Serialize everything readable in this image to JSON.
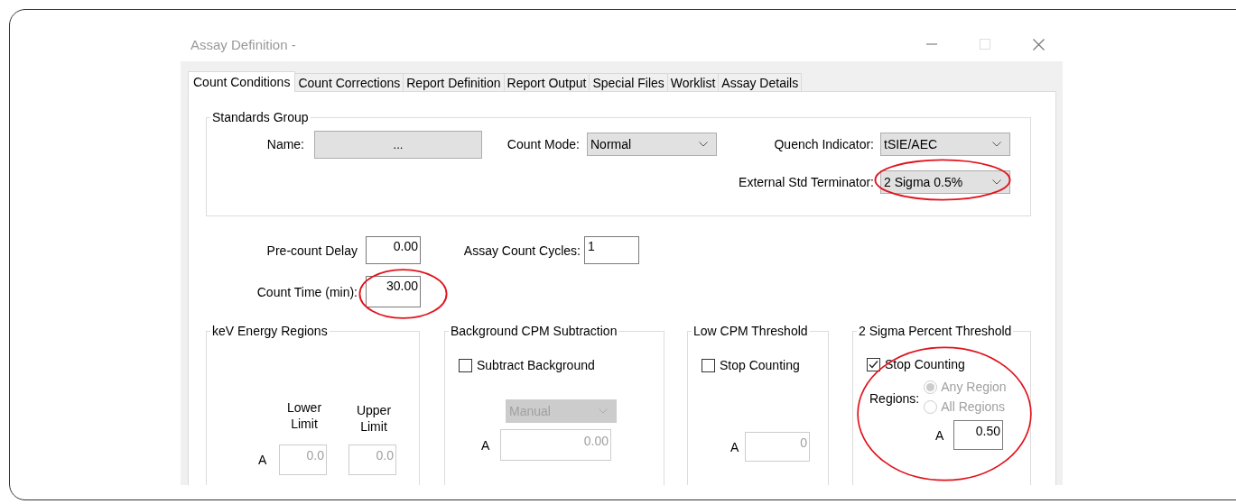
{
  "window": {
    "title": "Assay Definition -"
  },
  "tabs": [
    {
      "label": "Count Conditions",
      "selected": true
    },
    {
      "label": "Count Corrections",
      "selected": false
    },
    {
      "label": "Report Definition",
      "selected": false
    },
    {
      "label": "Report Output",
      "selected": false
    },
    {
      "label": "Special Files",
      "selected": false
    },
    {
      "label": "Worklist",
      "selected": false
    },
    {
      "label": "Assay Details",
      "selected": false
    }
  ],
  "standards_group": {
    "title": "Standards Group",
    "name": {
      "label": "Name:",
      "button": "..."
    },
    "count_mode": {
      "label": "Count Mode:",
      "value": "Normal"
    },
    "quench_indicator": {
      "label": "Quench Indicator:",
      "value": "tSIE/AEC"
    },
    "external_std_terminator": {
      "label": "External Std Terminator:",
      "value": "2 Sigma 0.5%",
      "highlighted": true
    }
  },
  "pre_count_delay": {
    "label": "Pre-count Delay",
    "value": "0.00"
  },
  "assay_count_cycles": {
    "label": "Assay Count Cycles:",
    "value": "1"
  },
  "count_time": {
    "label": "Count Time (min):",
    "value": "30.00",
    "highlighted": true
  },
  "kev_energy_regions": {
    "title": "keV Energy Regions",
    "columns": [
      "Lower Limit",
      "Upper Limit"
    ],
    "rows": [
      {
        "label": "A",
        "lower": "0.0",
        "upper": "0.0",
        "disabled": true
      }
    ]
  },
  "background_subtraction": {
    "title": "Background CPM Subtraction",
    "checkbox": {
      "label": "Subtract Background",
      "checked": false
    },
    "method": {
      "value": "Manual",
      "disabled": true
    },
    "rows": [
      {
        "label": "A",
        "value": "0.00",
        "disabled": true
      }
    ]
  },
  "low_cpm_threshold": {
    "title": "Low CPM Threshold",
    "checkbox": {
      "label": "Stop Counting",
      "checked": false
    },
    "rows": [
      {
        "label": "A",
        "value": "0",
        "disabled": true
      }
    ]
  },
  "sigma_threshold": {
    "title": "2 Sigma Percent Threshold",
    "highlighted": true,
    "checkbox": {
      "label": "Stop Counting",
      "checked": true
    },
    "regions": {
      "label": "Regions:",
      "options": [
        {
          "label": "Any Region",
          "selected": true,
          "disabled": true
        },
        {
          "label": "All Regions",
          "selected": false,
          "disabled": true
        }
      ]
    },
    "rows": [
      {
        "label": "A",
        "value": "0.50",
        "disabled": false
      }
    ]
  }
}
